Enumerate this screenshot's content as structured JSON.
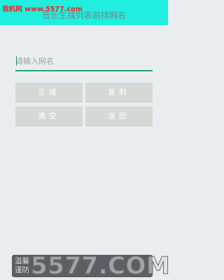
{
  "watermark": {
    "top": "我机网 www.5577.com",
    "bottom": "5577.COM"
  },
  "header": {
    "title": "音乐生成列表前排网名"
  },
  "input": {
    "placeholder": "请输入网名",
    "value": ""
  },
  "buttons": {
    "generate": "生成",
    "copy": "复制",
    "clear": "清空",
    "back": "返回"
  },
  "toast": {
    "line1": "温馨",
    "line2": "谨防"
  },
  "colors": {
    "topbar": "#20efe0",
    "accent": "#2d9a8c",
    "button": "#d5d8d5",
    "background": "#e9edf0"
  }
}
